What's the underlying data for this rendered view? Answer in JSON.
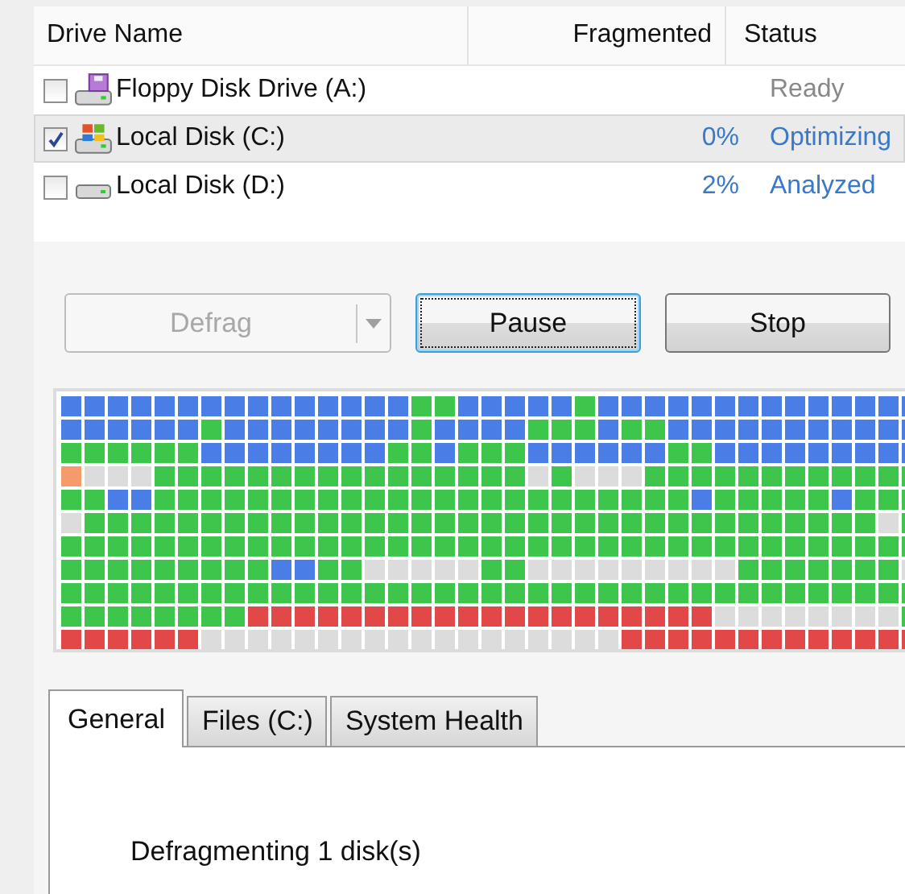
{
  "columns": [
    {
      "label": "Drive Name"
    },
    {
      "label": "Fragmented"
    },
    {
      "label": "Status"
    }
  ],
  "drives": [
    {
      "name": "Floppy Disk Drive (A:)",
      "kind": "floppy",
      "checked": false,
      "selected": false,
      "status": {
        "text": "Ready",
        "active": false
      }
    },
    {
      "name": "Local Disk (C:)",
      "kind": "system",
      "checked": true,
      "selected": true,
      "fragmented": "0%",
      "status": {
        "text": "Optimizing",
        "active": true
      }
    },
    {
      "name": "Local Disk (D:)",
      "kind": "disk",
      "checked": false,
      "selected": false,
      "fragmented": "2%",
      "status": {
        "text": "Analyzed",
        "active": true
      }
    }
  ],
  "buttons": [
    {
      "label": "Defrag",
      "kind": "split",
      "disabled": true,
      "focused": false
    },
    {
      "label": "Pause",
      "kind": "push",
      "disabled": false,
      "focused": true
    },
    {
      "label": "Stop",
      "kind": "push",
      "disabled": false,
      "focused": false
    }
  ],
  "tabs": [
    {
      "label": "General",
      "selected": true
    },
    {
      "label": "Files (C:)",
      "selected": false
    },
    {
      "label": "System Health",
      "selected": false
    }
  ],
  "tab_panel": {
    "message": "Defragmenting 1 disk(s)"
  }
}
